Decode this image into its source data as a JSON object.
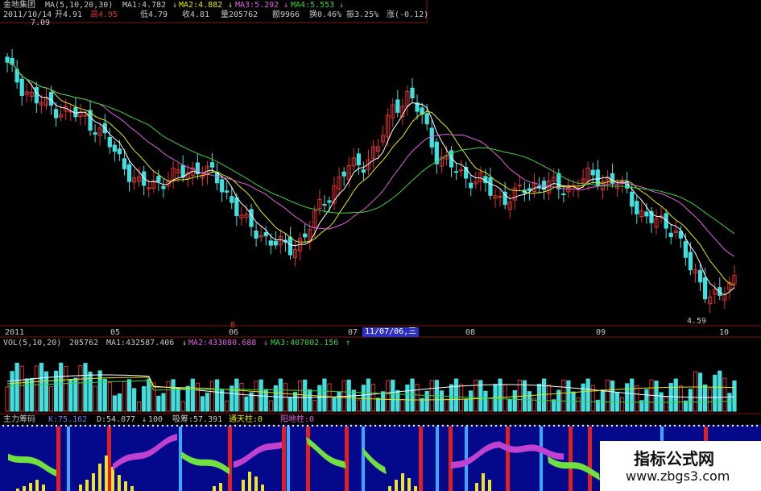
{
  "header": {
    "stock_name": "金地集团",
    "ma_params": "MA(5,10,20,30)",
    "ma1": "MA1:4.782",
    "ma2": "MA2:4.882",
    "ma3": "MA3:5.292",
    "ma4": "MA4:5.553",
    "arrow_down": "↓",
    "date": "2011/10/14",
    "open": "开4.91",
    "high": "高4.95",
    "low": "低4.79",
    "close": "收4.81",
    "volume": "量205762",
    "amount": "额9966",
    "turnover": "换0.46%",
    "amplitude": "振3.25%",
    "change": "涨(-0.12)"
  },
  "price_panel": {
    "high_label": "7.09",
    "low_label": "4.59",
    "marker_label": "8"
  },
  "time_axis": {
    "labels": [
      "2011",
      "05",
      "06",
      "07",
      "08",
      "09",
      "10"
    ],
    "cursor_label": "11/07/06,三"
  },
  "vol_panel": {
    "params": "VOL(5,10,20)",
    "value": "205762",
    "ma1": "MA1:432587.406",
    "ma2": "MA2:433080.688",
    "ma3": "MA3:407002.156",
    "arrow_up": "↑",
    "arrow_down": "↓"
  },
  "indicator_panel": {
    "name": "主力筹码",
    "k": "K:75.162",
    "d": "D:54.077",
    "v100": "100",
    "xichou": "吸筹:57.391",
    "tongtianzhu": "通天柱:0",
    "kaichuzhu": "阳地柱:0"
  },
  "watermark": {
    "title": "指标公式网",
    "url": "www.zbgs3.com"
  },
  "colors": {
    "up": "#e03030",
    "down": "#40e0e0",
    "ma5": "#ffffff",
    "ma10": "#e8e800",
    "ma20": "#e060e0",
    "ma30": "#40d040",
    "indicator_bg": "#04088a"
  },
  "chart_data": {
    "type": "candlestick",
    "title": "金地集团",
    "xlabel": "",
    "ylabel": "",
    "x_labels": [
      "2011",
      "05",
      "06",
      "07",
      "08",
      "09",
      "10"
    ],
    "ylim": [
      4.4,
      7.3
    ],
    "price_high": 7.09,
    "price_low": 4.59,
    "close_path": [
      6.9,
      6.7,
      6.55,
      6.5,
      6.45,
      6.4,
      6.3,
      6.1,
      5.9,
      5.7,
      5.75,
      5.8,
      5.85,
      5.9,
      5.8,
      5.6,
      5.35,
      5.25,
      5.15,
      5.1,
      5.2,
      5.5,
      5.7,
      5.9,
      5.95,
      6.1,
      6.5,
      6.6,
      6.4,
      6.0,
      5.9,
      5.8,
      5.75,
      5.6,
      5.6,
      5.7,
      5.75,
      5.7,
      5.7,
      5.8,
      5.8,
      5.75,
      5.6,
      5.4,
      5.35,
      5.3,
      4.9,
      4.7,
      4.6,
      4.8
    ],
    "series": [
      {
        "name": "MA5",
        "value": 4.782
      },
      {
        "name": "MA10",
        "value": 4.882
      },
      {
        "name": "MA20",
        "value": 5.292
      },
      {
        "name": "MA30",
        "value": 5.553
      }
    ],
    "volume_ma": [
      432587.406,
      433080.688,
      407002.156
    ],
    "volume_last": 205762
  }
}
